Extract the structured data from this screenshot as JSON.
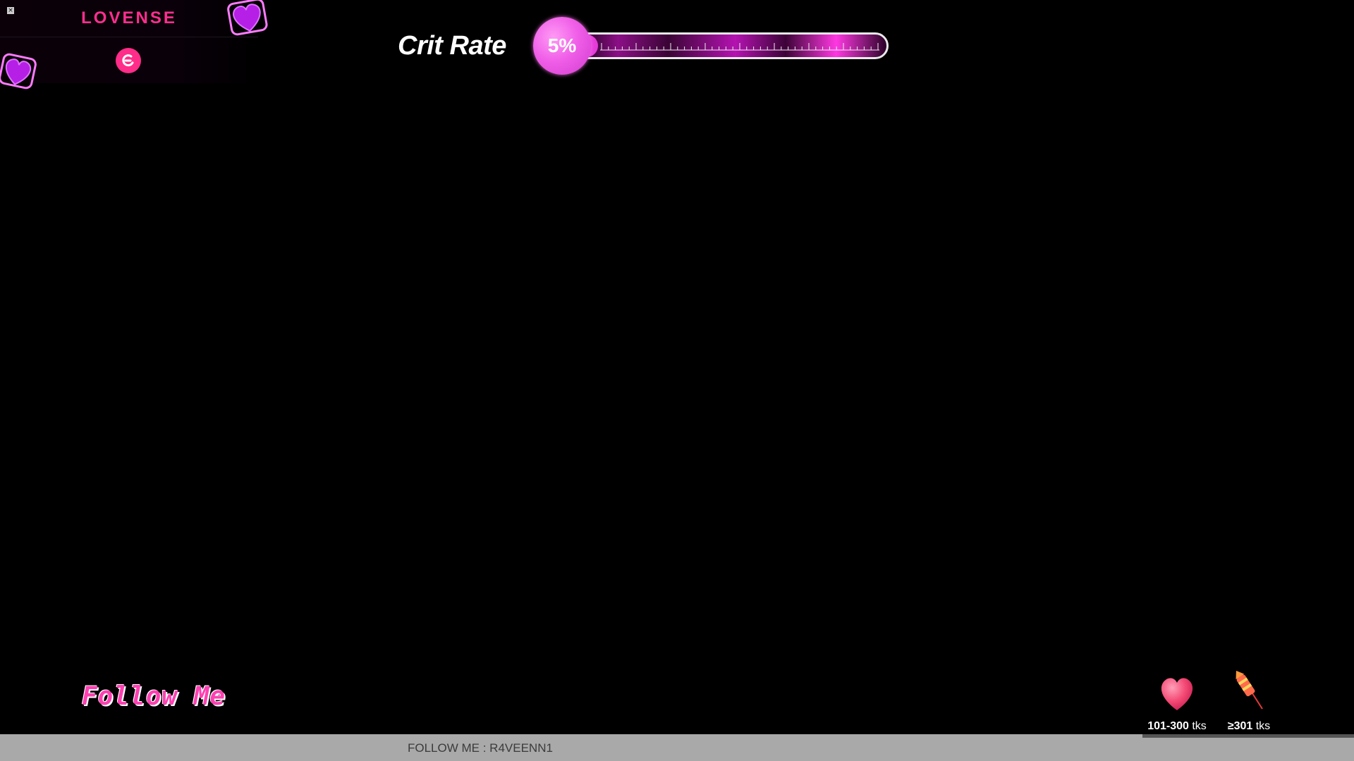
{
  "lovense_panel": {
    "logo_text": "LOVENSE",
    "close_glyph": "×",
    "icons": [
      "heart-icon",
      "heart-icon",
      "lovense-control-icon"
    ]
  },
  "crit_rate": {
    "label": "Crit Rate",
    "value_text": "5%",
    "value": 0.05
  },
  "follow_me": {
    "text": "Follow Me"
  },
  "tip_levels": [
    {
      "icon": "heart-icon",
      "range": "101-300",
      "unit": "tks"
    },
    {
      "icon": "firework-rocket-icon",
      "range": "≥301",
      "unit": "tks"
    }
  ],
  "ticker": {
    "text": "FOLLOW ME : R4VEENN1"
  },
  "colors": {
    "accent_pink": "#ff2f8f",
    "bar_magenta": "#e23ad8",
    "background": "#000000",
    "bottom_bar": "#a9a9a9"
  }
}
